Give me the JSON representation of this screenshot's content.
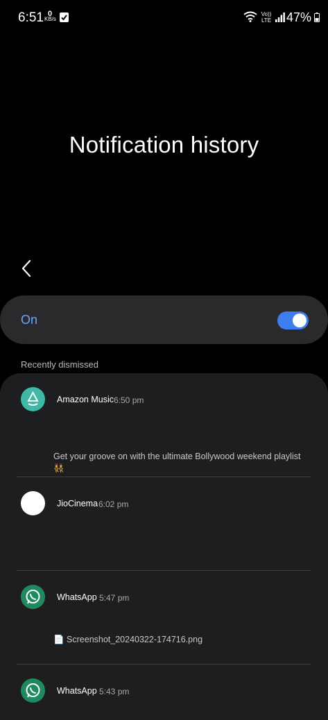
{
  "status_bar": {
    "time": "6:51",
    "net_speed_value": "0",
    "net_speed_unit": "KB/s",
    "volte_text": "Vo)) LTE",
    "battery": "47%"
  },
  "page": {
    "title": "Notification history"
  },
  "toggle": {
    "label": "On",
    "state": "on",
    "accent_color": "#3d7df0"
  },
  "section": {
    "header": "Recently dismissed"
  },
  "notifications": [
    {
      "icon": "amazon-music-icon",
      "app": "Amazon Music",
      "time": "6:50 pm",
      "text": "Get your groove on with the ultimate Bollywood weekend playlist 👯"
    },
    {
      "icon": "jiocinema-icon",
      "app": "JioCinema",
      "time": "6:02 pm",
      "text": ""
    },
    {
      "icon": "whatsapp-icon",
      "app": "WhatsApp",
      "time": "5:47 pm",
      "text": "📄 Screenshot_20240322-174716.png"
    },
    {
      "icon": "whatsapp-icon",
      "app": "WhatsApp",
      "time": "5:43 pm",
      "text": ""
    }
  ]
}
